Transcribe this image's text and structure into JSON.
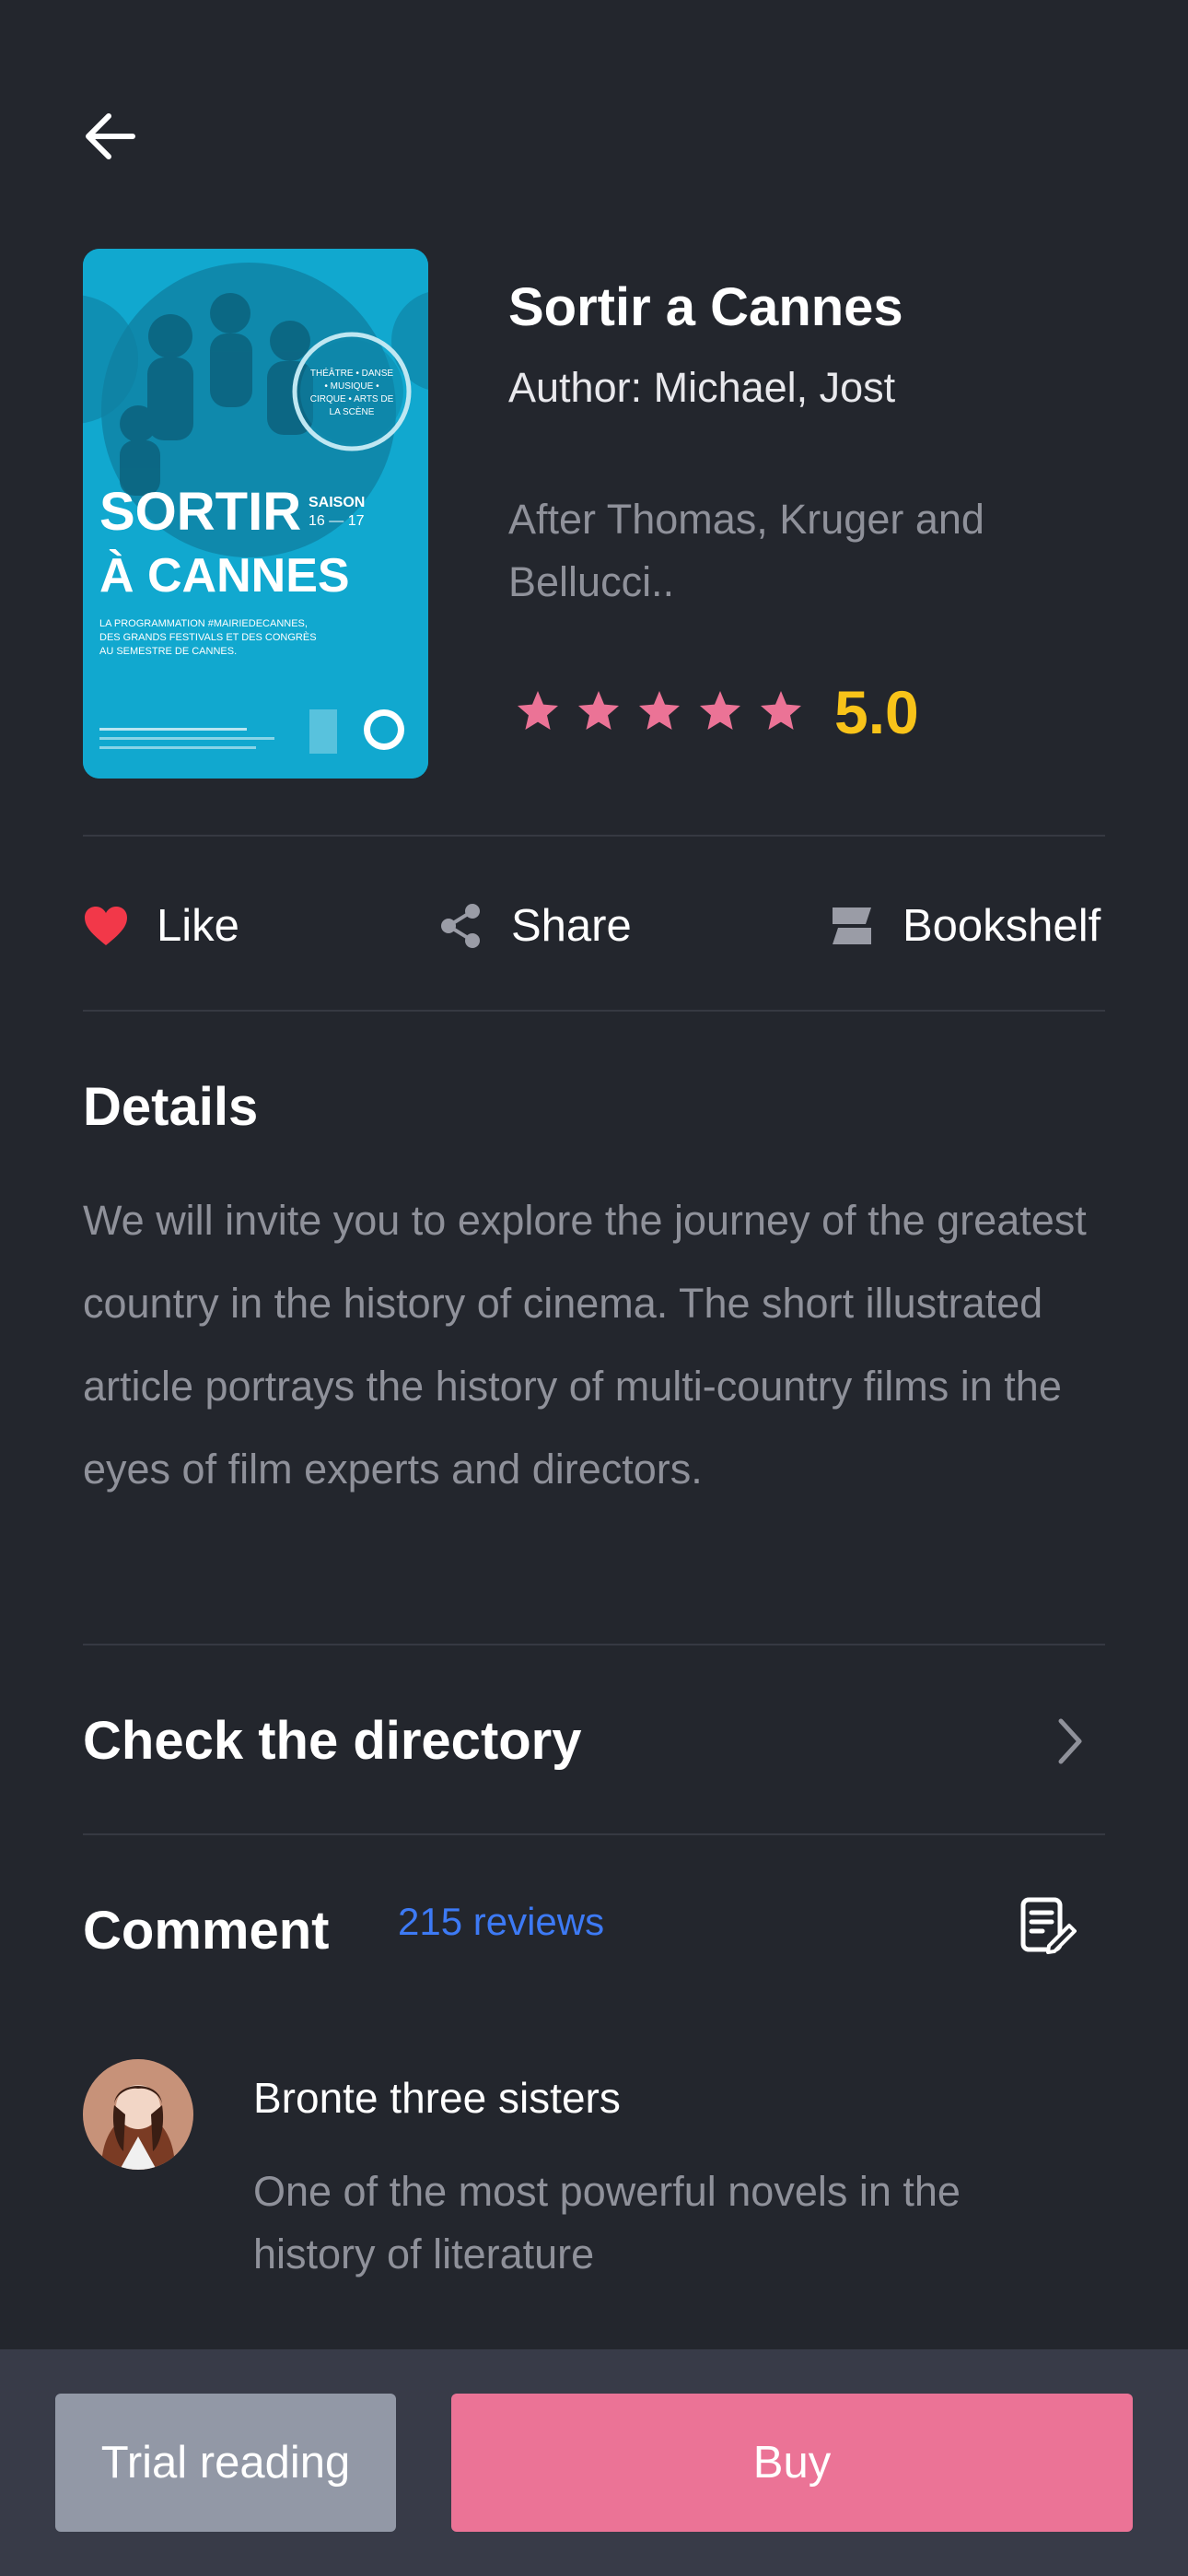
{
  "book": {
    "title": "Sortir a Cannes",
    "author": "Author: Michael, Jost",
    "description": "After Thomas, Kruger and Bellucci..",
    "rating": "5.0",
    "star_count": 5,
    "cover": {
      "title_line1": "SORTIR",
      "title_line2": "À CANNES",
      "saison_label": "SAISON",
      "saison_years": "16 — 17",
      "badge_lines": [
        "THÉÂTRE • DANSE",
        "• MUSIQUE •",
        "CIRQUE • ARTS DE",
        "LA SCÈNE"
      ],
      "program_line1": "LA PROGRAMMATION #MAIRIEDECANNES,",
      "program_line2": "DES GRANDS FESTIVALS ET DES CONGRÈS",
      "program_line3": "AU SEMESTRE DE CANNES."
    }
  },
  "actions": {
    "like": "Like",
    "share": "Share",
    "bookshelf": "Bookshelf"
  },
  "details": {
    "heading": "Details",
    "text": "We will invite you to explore the journey of the greatest country in the history of cinema. The short illustrated article portrays the history of multi-country films in the eyes of film experts and directors."
  },
  "directory": {
    "label": "Check the directory"
  },
  "comments": {
    "heading": "Comment",
    "count_label": "215 reviews",
    "items": [
      {
        "author": "Bronte three sisters",
        "text": "One of the most powerful novels in the history of literature"
      }
    ]
  },
  "footer": {
    "trial_label": "Trial reading",
    "buy_label": "Buy"
  },
  "colors": {
    "background": "#23262d",
    "accent_pink": "#eb7396",
    "rating_yellow": "#f8c319",
    "link_blue": "#3d7af5"
  }
}
